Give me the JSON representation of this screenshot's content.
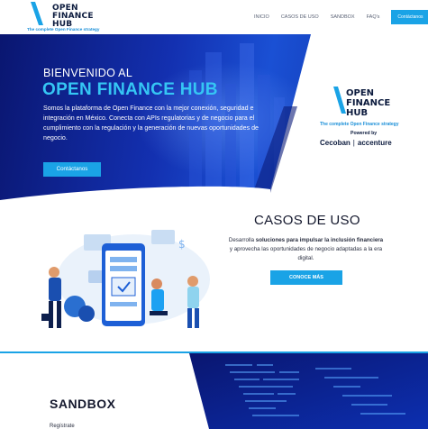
{
  "header": {
    "logo": {
      "line1": "OPEN",
      "line2": "FINANCE",
      "line3": "HUB",
      "tagline": "The complete Open Finance strategy"
    },
    "nav": [
      "INICIO",
      "CASOS DE USO",
      "SANDBOX",
      "FAQ's"
    ],
    "cta_label": "Contáctanos"
  },
  "hero": {
    "kicker": "BIENVENIDO AL",
    "title": "OPEN FINANCE HUB",
    "description": "Somos la plataforma de Open Finance con la mejor conexión, seguridad e integración en México. Conecta con APIs regulatorias y de negocio para el cumplimiento con la regulación y la generación de nuevas oportunidades de negocio.",
    "button_label": "Contáctanos",
    "brand": {
      "line1": "OPEN",
      "line2": "FINANCE",
      "line3": "HUB",
      "tagline": "The complete Open Finance strategy",
      "powered_by": "Powered by",
      "partner1": "Cecoban",
      "partner2": "accenture"
    }
  },
  "cases": {
    "title": "CASOS DE USO",
    "desc_prefix": "Desarrolla ",
    "desc_bold": "soluciones para impulsar la inclusión financiera",
    "desc_suffix": " y aprovecha las oportunidades de negocio adaptadas a la era digital.",
    "button_label": "CONOCE MÁS"
  },
  "sandbox": {
    "title": "SANDBOX",
    "subtitle": "Regístrate"
  },
  "colors": {
    "accent": "#1aa3e6",
    "hero_title": "#35c6f4",
    "navy": "#0b1a3d",
    "hero_bg": "#1330b0"
  },
  "icons": [
    "logo-slash-icon",
    "dollar-icon",
    "checkmark-icon",
    "accenture-chevron-icon"
  ]
}
